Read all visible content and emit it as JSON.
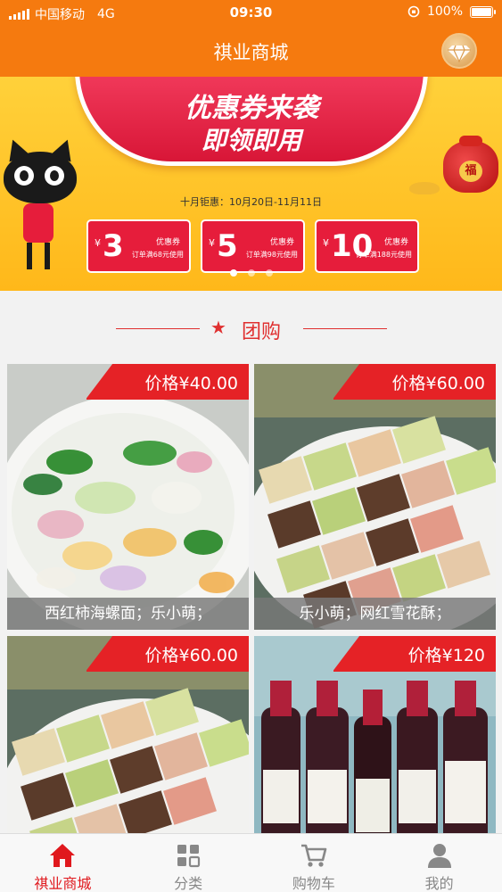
{
  "status_bar": {
    "carrier": "中国移动",
    "network": "4G",
    "time": "09:30",
    "battery": "100%",
    "battery_level": 1.0
  },
  "nav": {
    "title": "祺业商城",
    "diamond_icon": "diamond-icon"
  },
  "banner": {
    "title_line1": "优惠券来袭",
    "title_line2": "即领即用",
    "date_text": "十月钜惠：10月20日-11月11日",
    "coupons": [
      {
        "symbol": "¥",
        "amount": "3",
        "label": "优惠券",
        "condition": "订单满68元使用"
      },
      {
        "symbol": "¥",
        "amount": "5",
        "label": "优惠券",
        "condition": "订单满98元使用"
      },
      {
        "symbol": "¥",
        "amount": "10",
        "label": "优惠券",
        "condition": "订单满188元使用"
      }
    ],
    "sack_char": "福",
    "slide_count": 3,
    "active_slide": 0
  },
  "section": {
    "title": "团购",
    "star_icon": "★"
  },
  "products": [
    {
      "price": "价格¥40.00",
      "caption": "西红柿海螺面；乐小萌；"
    },
    {
      "price": "价格¥60.00",
      "caption": "乐小萌；网红雪花酥；"
    },
    {
      "price": "价格¥60.00",
      "caption": ""
    },
    {
      "price": "价格¥120",
      "caption": ""
    }
  ],
  "tabs": [
    {
      "label": "祺业商城",
      "icon": "home-icon",
      "active": true
    },
    {
      "label": "分类",
      "icon": "category-icon",
      "active": false
    },
    {
      "label": "购物车",
      "icon": "cart-icon",
      "active": false
    },
    {
      "label": "我的",
      "icon": "user-icon",
      "active": false
    }
  ],
  "colors": {
    "brand_orange": "#f57a0f",
    "accent_red": "#e52226",
    "tab_active": "#e0181d",
    "tab_inactive": "#888888"
  }
}
